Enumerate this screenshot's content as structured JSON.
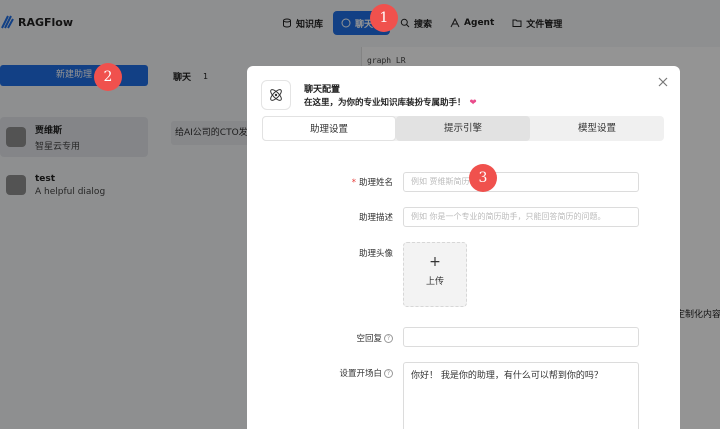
{
  "app": {
    "name": "RAGFlow"
  },
  "nav": [
    {
      "label": "知识库",
      "icon": "database-icon"
    },
    {
      "label": "聊天",
      "icon": "chat-icon"
    },
    {
      "label": "搜索",
      "icon": "search-icon"
    },
    {
      "label": "Agent",
      "icon": "agent-icon"
    },
    {
      "label": "文件管理",
      "icon": "folder-icon"
    }
  ],
  "sidebar": {
    "new_button": "新建助理",
    "assistants": [
      {
        "name": "贾维斯",
        "description": "智星云专用",
        "selected": true
      },
      {
        "name": "test",
        "description": "A helpful dialog",
        "selected": false
      }
    ]
  },
  "chat_list": {
    "title": "聊天",
    "count": "1",
    "items": [
      "给AI公司的CTO发"
    ]
  },
  "right_pane": {
    "code": "graph LR",
    "trailing_text": "定制化内容"
  },
  "modal": {
    "title": "聊天配置",
    "subtitle": "在这里，为你的专业知识库装扮专属助手！",
    "tabs": [
      "助理设置",
      "提示引擎",
      "模型设置"
    ],
    "fields": {
      "name": {
        "label": "助理姓名",
        "placeholder": "例如 贾维斯简历"
      },
      "description": {
        "label": "助理描述",
        "placeholder": "例如 你是一个专业的简历助手，只能回答简历的问题。"
      },
      "avatar": {
        "label": "助理头像",
        "plus": "+",
        "upload": "上传"
      },
      "empty_reply": {
        "label": "空回复",
        "value": ""
      },
      "opener": {
        "label": "设置开场白",
        "value": "你好！ 我是你的助理，有什么可以帮到你的吗？"
      }
    }
  },
  "steps": [
    "1",
    "2",
    "3"
  ],
  "colors": {
    "accent": "#1f6fe5",
    "badge": "#f0514d",
    "heart": "#e94b8b"
  }
}
